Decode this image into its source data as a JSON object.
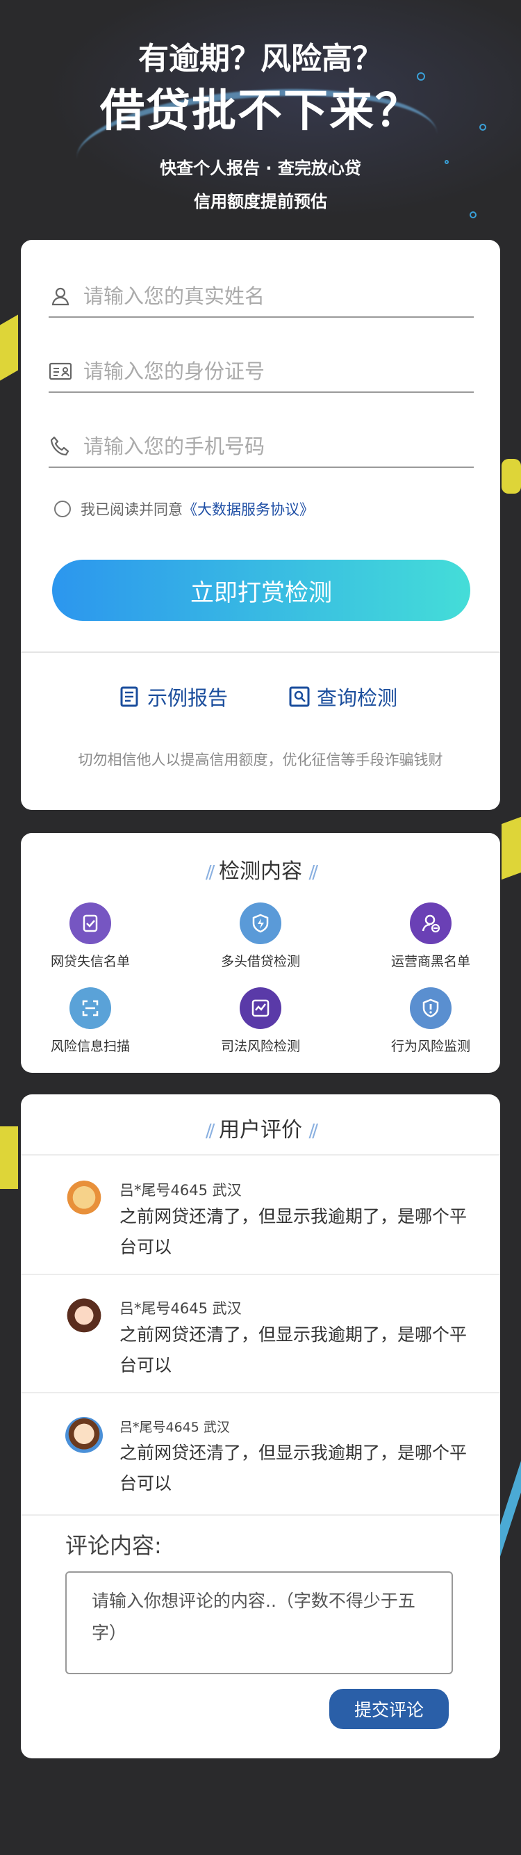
{
  "hero": {
    "line1": "有逾期？风险高？",
    "line2": "借贷批不下来？",
    "line3": "快查个人报告 · 查完放心贷",
    "line4": "信用额度提前预估"
  },
  "form": {
    "name_placeholder": "请输入您的真实姓名",
    "id_placeholder": "请输入您的身份证号",
    "phone_placeholder": "请输入您的手机号码",
    "agree_text": "我已阅读并同意",
    "agree_link": "《大数据服务协议》",
    "submit_label": "立即打赏检测",
    "sample_report": "示例报告",
    "query_check": "查询检测",
    "warning": "切勿相信他人以提高信用额度，优化征信等手段诈骗钱财"
  },
  "features": {
    "title": "检测内容",
    "items": [
      {
        "label": "网贷失信名单",
        "icon": "list-check-icon",
        "color": "#7656c2"
      },
      {
        "label": "多头借贷检测",
        "icon": "shield-bolt-icon",
        "color": "#5a9ad8"
      },
      {
        "label": "运营商黑名单",
        "icon": "user-blocked-icon",
        "color": "#6a40b5"
      },
      {
        "label": "风险信息扫描",
        "icon": "scan-icon",
        "color": "#5aa2d8"
      },
      {
        "label": "司法风险检测",
        "icon": "chart-monitor-icon",
        "color": "#5a3aa8"
      },
      {
        "label": "行为风险监测",
        "icon": "shield-alert-icon",
        "color": "#5a8fd0"
      }
    ]
  },
  "reviews": {
    "title": "用户评价",
    "items": [
      {
        "user": "吕*尾号4645  武汉",
        "text": "之前网贷还清了，但显示我逾期了，是哪个平台可以"
      },
      {
        "user": "吕*尾号4645  武汉",
        "text": "之前网贷还清了，但显示我逾期了，是哪个平台可以"
      },
      {
        "user": "吕*尾号4645  武汉",
        "text": "之前网贷还清了，但显示我逾期了，是哪个平台可以"
      }
    ]
  },
  "comment": {
    "label": "评论内容:",
    "placeholder": "请输入你想评论的内容..（字数不得少于五字）",
    "submit_label": "提交评论"
  },
  "colors": {
    "accent_blue": "#2c96ee",
    "accent_teal": "#44ddd8",
    "link_blue": "#1f4fa5",
    "button_dark": "#2a5fa8"
  }
}
